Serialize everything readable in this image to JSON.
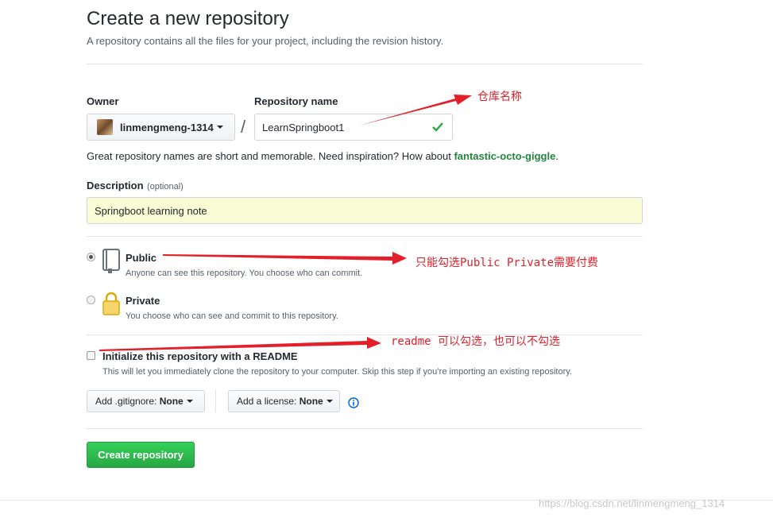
{
  "header": {
    "title": "Create a new repository",
    "subtitle": "A repository contains all the files for your project, including the revision history."
  },
  "owner": {
    "label": "Owner",
    "value": "linmengmeng-1314"
  },
  "separator": "/",
  "repo_name": {
    "label": "Repository name",
    "value": "LearnSpringboot1"
  },
  "name_hint": {
    "text": "Great repository names are short and memorable. Need inspiration? How about ",
    "suggestion": "fantastic-octo-giggle",
    "end": "."
  },
  "description": {
    "label": "Description",
    "optional": "(optional)",
    "value": "Springboot learning note"
  },
  "visibility": {
    "public": {
      "label": "Public",
      "note": "Anyone can see this repository. You choose who can commit."
    },
    "private": {
      "label": "Private",
      "note": "You choose who can see and commit to this repository."
    }
  },
  "readme": {
    "label": "Initialize this repository with a README",
    "note": "This will let you immediately clone the repository to your computer. Skip this step if you’re importing an existing repository."
  },
  "gitignore": {
    "prefix": "Add .gitignore:",
    "value": "None"
  },
  "license": {
    "prefix": "Add a license:",
    "value": "None"
  },
  "create_button": "Create repository",
  "annotations": {
    "repo_name": "仓库名称",
    "public": "只能勾选Public  Private需要付费",
    "readme": "readme 可以勾选，也可以不勾选"
  },
  "watermark": "https://blog.csdn.net/linmengmeng_1314",
  "colors": {
    "accent_green": "#28a745",
    "annotation_red": "#e3202a",
    "description_bg": "#fafcd5"
  }
}
